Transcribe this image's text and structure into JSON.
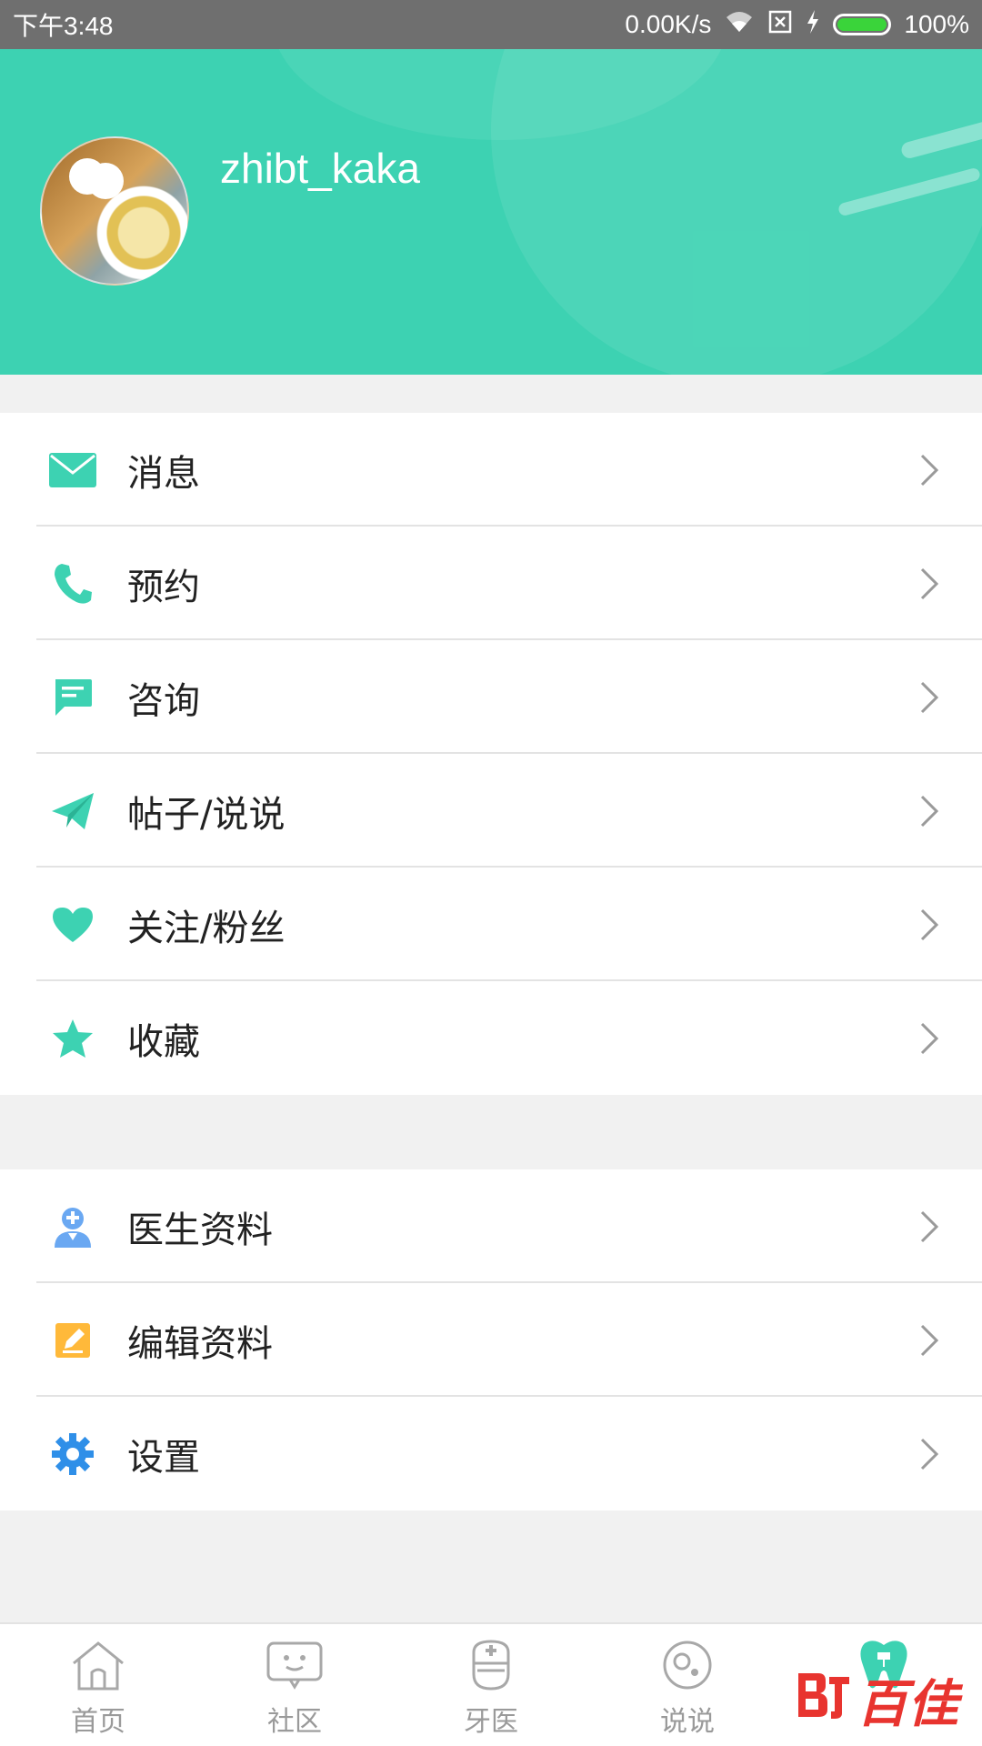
{
  "status": {
    "time": "下午3:48",
    "network_speed": "0.00K/s",
    "battery": "100%",
    "battery_level": 1.0
  },
  "profile": {
    "username": "zhibt_kaka"
  },
  "colors": {
    "header": "#3dd2b2",
    "accent": "#3dd2b2",
    "doctor_icon": "#6aa8f2",
    "edit_icon": "#ffb93a",
    "settings_icon": "#2f8fe8"
  },
  "menu_group1": [
    {
      "label": "消息",
      "icon": "mail-icon"
    },
    {
      "label": "预约",
      "icon": "phone-icon"
    },
    {
      "label": "咨询",
      "icon": "chat-icon"
    },
    {
      "label": "帖子/说说",
      "icon": "paper-plane-icon"
    },
    {
      "label": "关注/粉丝",
      "icon": "heart-icon"
    },
    {
      "label": "收藏",
      "icon": "star-icon"
    }
  ],
  "menu_group2": [
    {
      "label": "医生资料",
      "icon": "doctor-icon"
    },
    {
      "label": "编辑资料",
      "icon": "edit-icon"
    },
    {
      "label": "设置",
      "icon": "gear-icon"
    }
  ],
  "tabbar": [
    {
      "label": "首页",
      "icon": "home-icon"
    },
    {
      "label": "社区",
      "icon": "community-icon"
    },
    {
      "label": "牙医",
      "icon": "dentist-icon"
    },
    {
      "label": "说说",
      "icon": "moments-icon"
    },
    {
      "label": "",
      "icon": "tooth-icon",
      "active": true
    }
  ],
  "watermark": {
    "text": "百佳"
  }
}
